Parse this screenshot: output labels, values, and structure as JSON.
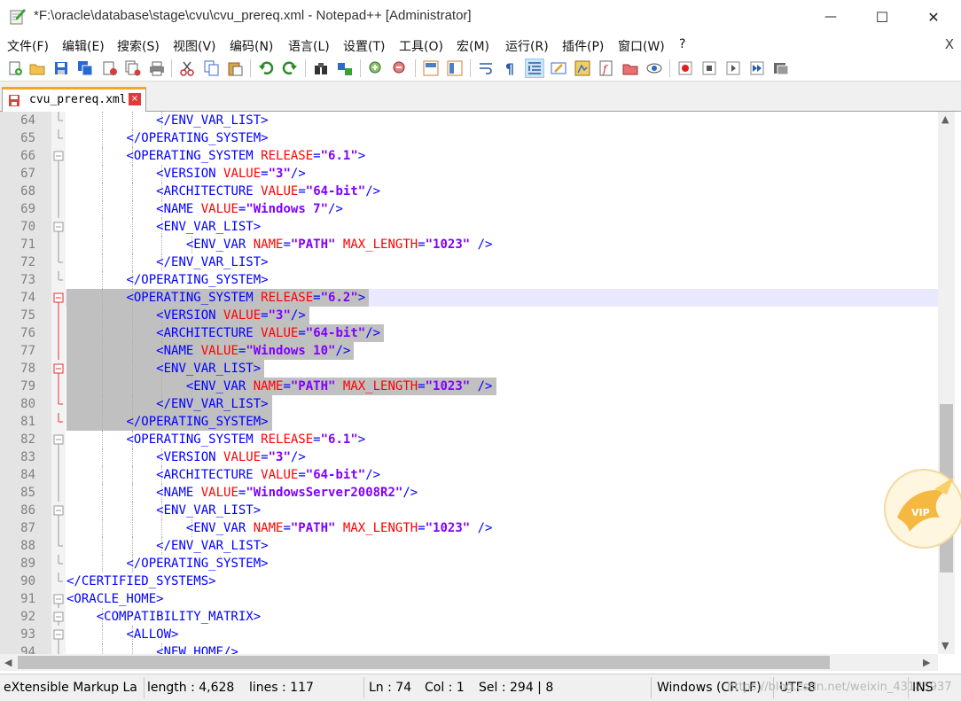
{
  "window": {
    "title": "*F:\\oracle\\database\\stage\\cvu\\cvu_prereq.xml - Notepad++ [Administrator]",
    "min_glyph": "—",
    "max_glyph": "☐",
    "close_glyph": "✕"
  },
  "menu": {
    "items": [
      "文件(F)",
      "编辑(E)",
      "搜索(S)",
      "视图(V)",
      "编码(N)",
      "语言(L)",
      "设置(T)",
      "工具(O)",
      "宏(M)",
      "运行(R)",
      "插件(P)",
      "窗口(W)",
      "?"
    ],
    "close_glyph": "X"
  },
  "toolbar": {
    "buttons": [
      "new-file",
      "open-file",
      "save",
      "save-all",
      "close",
      "close-all",
      "print",
      "cut",
      "copy",
      "paste",
      "undo",
      "redo",
      "find",
      "replace",
      "zoom-in",
      "zoom-out",
      "sync-vertical",
      "sync-horizontal",
      "word-wrap",
      "show-all-chars",
      "indent-guide",
      "user-defined-lang",
      "doc-map",
      "function-list",
      "folder-as-workspace",
      "monitoring",
      "record-macro",
      "stop-record",
      "playback-macro",
      "run-macro-multiple",
      "save-macro"
    ]
  },
  "tab": {
    "label": "cvu_prereq.xml",
    "close_glyph": "×"
  },
  "editor": {
    "lines": [
      {
        "n": "64",
        "fold": "end",
        "guides": [
          4
        ],
        "tokens": [
          [
            "t",
            "            "
          ],
          [
            "tag",
            "</ENV_VAR_LIST>"
          ]
        ]
      },
      {
        "n": "65",
        "fold": "end",
        "guides": [],
        "tokens": [
          [
            "t",
            "        "
          ],
          [
            "tag",
            "</OPERATING_SYSTEM>"
          ]
        ]
      },
      {
        "n": "66",
        "fold": "open",
        "guides": [],
        "tokens": [
          [
            "t",
            "        "
          ],
          [
            "tag",
            "<OPERATING_SYSTEM "
          ],
          [
            "attr",
            "RELEASE"
          ],
          [
            "tag",
            "="
          ],
          [
            "val",
            "\"6.1\""
          ],
          [
            "tag",
            ">"
          ]
        ]
      },
      {
        "n": "67",
        "fold": "line",
        "guides": [],
        "tokens": [
          [
            "t",
            "            "
          ],
          [
            "tag",
            "<VERSION "
          ],
          [
            "attr",
            "VALUE"
          ],
          [
            "tag",
            "="
          ],
          [
            "val",
            "\"3\""
          ],
          [
            "tag",
            "/>"
          ]
        ]
      },
      {
        "n": "68",
        "fold": "line",
        "guides": [],
        "tokens": [
          [
            "t",
            "            "
          ],
          [
            "tag",
            "<ARCHITECTURE "
          ],
          [
            "attr",
            "VALUE"
          ],
          [
            "tag",
            "="
          ],
          [
            "val",
            "\"64-bit\""
          ],
          [
            "tag",
            "/>"
          ]
        ]
      },
      {
        "n": "69",
        "fold": "line",
        "guides": [],
        "tokens": [
          [
            "t",
            "            "
          ],
          [
            "tag",
            "<NAME "
          ],
          [
            "attr",
            "VALUE"
          ],
          [
            "tag",
            "="
          ],
          [
            "val",
            "\"Windows 7\""
          ],
          [
            "tag",
            "/>"
          ]
        ]
      },
      {
        "n": "70",
        "fold": "open",
        "guides": [],
        "tokens": [
          [
            "t",
            "            "
          ],
          [
            "tag",
            "<ENV_VAR_LIST>"
          ]
        ]
      },
      {
        "n": "71",
        "fold": "line",
        "guides": [],
        "tokens": [
          [
            "t",
            "                "
          ],
          [
            "tag",
            "<ENV_VAR "
          ],
          [
            "attr",
            "NAME"
          ],
          [
            "tag",
            "="
          ],
          [
            "val",
            "\"PATH\""
          ],
          [
            "tag",
            " "
          ],
          [
            "attr",
            "MAX_LENGTH"
          ],
          [
            "tag",
            "="
          ],
          [
            "val",
            "\"1023\""
          ],
          [
            "tag",
            " />"
          ]
        ]
      },
      {
        "n": "72",
        "fold": "end",
        "guides": [],
        "tokens": [
          [
            "t",
            "            "
          ],
          [
            "tag",
            "</ENV_VAR_LIST>"
          ]
        ]
      },
      {
        "n": "73",
        "fold": "end",
        "guides": [],
        "tokens": [
          [
            "t",
            "        "
          ],
          [
            "tag",
            "</OPERATING_SYSTEM>"
          ]
        ]
      },
      {
        "n": "74",
        "fold": "openr",
        "guides": [],
        "tokens": [
          [
            "t",
            "        "
          ],
          [
            "tag",
            "<OPERATING_SYSTEM "
          ],
          [
            "attr",
            "RELEASE"
          ],
          [
            "tag",
            "="
          ],
          [
            "val",
            "\"6.2\""
          ],
          [
            "tag",
            ">"
          ]
        ]
      },
      {
        "n": "75",
        "fold": "liner",
        "guides": [],
        "tokens": [
          [
            "t",
            "            "
          ],
          [
            "tag",
            "<VERSION "
          ],
          [
            "attr",
            "VALUE"
          ],
          [
            "tag",
            "="
          ],
          [
            "val",
            "\"3\""
          ],
          [
            "tag",
            "/>"
          ]
        ]
      },
      {
        "n": "76",
        "fold": "liner",
        "guides": [],
        "tokens": [
          [
            "t",
            "            "
          ],
          [
            "tag",
            "<ARCHITECTURE "
          ],
          [
            "attr",
            "VALUE"
          ],
          [
            "tag",
            "="
          ],
          [
            "val",
            "\"64-bit\""
          ],
          [
            "tag",
            "/>"
          ]
        ]
      },
      {
        "n": "77",
        "fold": "liner",
        "guides": [],
        "tokens": [
          [
            "t",
            "            "
          ],
          [
            "tag",
            "<NAME "
          ],
          [
            "attr",
            "VALUE"
          ],
          [
            "tag",
            "="
          ],
          [
            "val",
            "\"Windows 10\""
          ],
          [
            "tag",
            "/>"
          ]
        ]
      },
      {
        "n": "78",
        "fold": "openr",
        "guides": [],
        "tokens": [
          [
            "t",
            "            "
          ],
          [
            "tag",
            "<ENV_VAR_LIST>"
          ]
        ]
      },
      {
        "n": "79",
        "fold": "liner",
        "guides": [],
        "tokens": [
          [
            "t",
            "                "
          ],
          [
            "tag",
            "<ENV_VAR "
          ],
          [
            "attr",
            "NAME"
          ],
          [
            "tag",
            "="
          ],
          [
            "val",
            "\"PATH\""
          ],
          [
            "tag",
            " "
          ],
          [
            "attr",
            "MAX_LENGTH"
          ],
          [
            "tag",
            "="
          ],
          [
            "val",
            "\"1023\""
          ],
          [
            "tag",
            " />"
          ]
        ]
      },
      {
        "n": "80",
        "fold": "endr",
        "guides": [],
        "tokens": [
          [
            "t",
            "            "
          ],
          [
            "tag",
            "</ENV_VAR_LIST>"
          ]
        ]
      },
      {
        "n": "81",
        "fold": "endr",
        "guides": [],
        "tokens": [
          [
            "t",
            "        "
          ],
          [
            "tag",
            "</OPERATING_SYSTEM>"
          ]
        ]
      },
      {
        "n": "82",
        "fold": "open",
        "guides": [],
        "tokens": [
          [
            "t",
            "        "
          ],
          [
            "tag",
            "<OPERATING_SYSTEM "
          ],
          [
            "attr",
            "RELEASE"
          ],
          [
            "tag",
            "="
          ],
          [
            "val",
            "\"6.1\""
          ],
          [
            "tag",
            ">"
          ]
        ]
      },
      {
        "n": "83",
        "fold": "line",
        "guides": [],
        "tokens": [
          [
            "t",
            "            "
          ],
          [
            "tag",
            "<VERSION "
          ],
          [
            "attr",
            "VALUE"
          ],
          [
            "tag",
            "="
          ],
          [
            "val",
            "\"3\""
          ],
          [
            "tag",
            "/>"
          ]
        ]
      },
      {
        "n": "84",
        "fold": "line",
        "guides": [],
        "tokens": [
          [
            "t",
            "            "
          ],
          [
            "tag",
            "<ARCHITECTURE "
          ],
          [
            "attr",
            "VALUE"
          ],
          [
            "tag",
            "="
          ],
          [
            "val",
            "\"64-bit\""
          ],
          [
            "tag",
            "/>"
          ]
        ]
      },
      {
        "n": "85",
        "fold": "line",
        "guides": [],
        "tokens": [
          [
            "t",
            "            "
          ],
          [
            "tag",
            "<NAME "
          ],
          [
            "attr",
            "VALUE"
          ],
          [
            "tag",
            "="
          ],
          [
            "val",
            "\"WindowsServer2008R2\""
          ],
          [
            "tag",
            "/>"
          ]
        ]
      },
      {
        "n": "86",
        "fold": "open",
        "guides": [],
        "tokens": [
          [
            "t",
            "            "
          ],
          [
            "tag",
            "<ENV_VAR_LIST>"
          ]
        ]
      },
      {
        "n": "87",
        "fold": "line",
        "guides": [],
        "tokens": [
          [
            "t",
            "                "
          ],
          [
            "tag",
            "<ENV_VAR "
          ],
          [
            "attr",
            "NAME"
          ],
          [
            "tag",
            "="
          ],
          [
            "val",
            "\"PATH\""
          ],
          [
            "tag",
            " "
          ],
          [
            "attr",
            "MAX_LENGTH"
          ],
          [
            "tag",
            "="
          ],
          [
            "val",
            "\"1023\""
          ],
          [
            "tag",
            " />"
          ]
        ]
      },
      {
        "n": "88",
        "fold": "end",
        "guides": [],
        "tokens": [
          [
            "t",
            "            "
          ],
          [
            "tag",
            "</ENV_VAR_LIST>"
          ]
        ]
      },
      {
        "n": "89",
        "fold": "end",
        "guides": [],
        "tokens": [
          [
            "t",
            "        "
          ],
          [
            "tag",
            "</OPERATING_SYSTEM>"
          ]
        ]
      },
      {
        "n": "90",
        "fold": "end",
        "guides": [],
        "tokens": [
          [
            "tag",
            "</CERTIFIED_SYSTEMS>"
          ]
        ]
      },
      {
        "n": "91",
        "fold": "open",
        "guides": [],
        "tokens": [
          [
            "tag",
            "<ORACLE_HOME>"
          ]
        ]
      },
      {
        "n": "92",
        "fold": "open",
        "guides": [],
        "tokens": [
          [
            "t",
            "    "
          ],
          [
            "tag",
            "<COMPATIBILITY_MATRIX>"
          ]
        ]
      },
      {
        "n": "93",
        "fold": "open",
        "guides": [],
        "tokens": [
          [
            "t",
            "        "
          ],
          [
            "tag",
            "<ALLOW>"
          ]
        ]
      },
      {
        "n": "94",
        "fold": "line",
        "guides": [],
        "tokens": [
          [
            "t",
            "            "
          ],
          [
            "tag",
            "<NEW_HOME/>"
          ]
        ]
      }
    ],
    "selection_start_line": "74",
    "selection_end_line": "81",
    "current_line": "74"
  },
  "status": {
    "language": "eXtensible Markup La",
    "length": "length : 4,628",
    "lines": "lines : 117",
    "ln": "Ln : 74",
    "col": "Col : 1",
    "sel": "Sel : 294 | 8",
    "eol": "Windows (CR LF)",
    "encoding": "UTF-8",
    "mode": "INS",
    "watermark": "https://blog.csdn.net/weixin_43186937"
  },
  "badge": {
    "text": "VIP"
  },
  "colors": {
    "tag": "#0000ff",
    "attr": "#ff0000",
    "value": "#8000ff",
    "selection": "#c0c0c0",
    "current_line": "#e8e8ff",
    "tab_accent": "#f5a623"
  }
}
